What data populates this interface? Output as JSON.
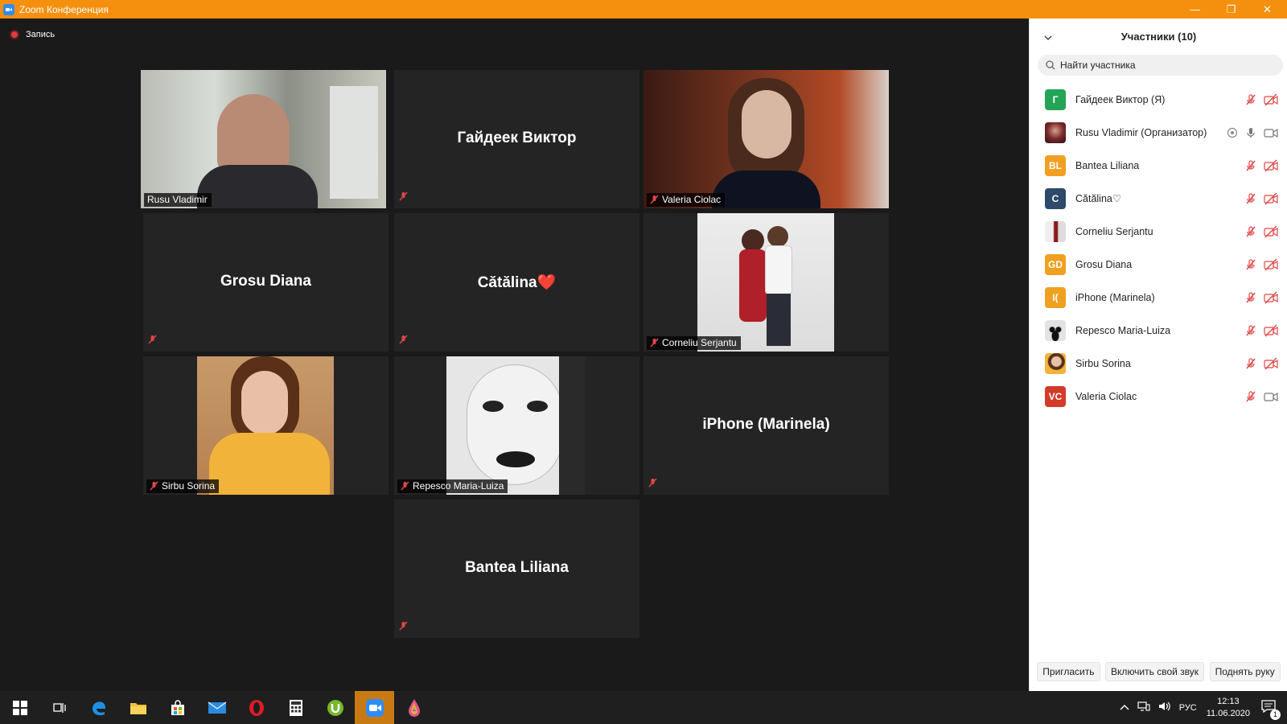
{
  "window": {
    "title": "Zoom Конференция",
    "minimize": "—",
    "restore": "❐",
    "close": "✕"
  },
  "recording": {
    "label": "Запись"
  },
  "tiles": [
    {
      "name": "Rusu Vladimir",
      "type": "video"
    },
    {
      "name": "Гайдеек Виктор",
      "type": "name"
    },
    {
      "name": "Valeria Ciolac",
      "type": "video"
    },
    {
      "name": "Grosu Diana",
      "type": "name"
    },
    {
      "name": "Cătălina❤️",
      "type": "name"
    },
    {
      "name": "Corneliu Serjantu",
      "type": "video"
    },
    {
      "name": "Sirbu Sorina",
      "type": "video"
    },
    {
      "name": "Repesco Maria-Luiza",
      "type": "video"
    },
    {
      "name": "iPhone (Marinela)",
      "type": "name"
    },
    {
      "name": "Bantea Liliana",
      "type": "name"
    }
  ],
  "panel": {
    "title": "Участники (10)",
    "search_placeholder": "Найти участника",
    "participants": [
      {
        "name": "Гайдеек Виктор (Я)",
        "initials": "Г",
        "color": "#23a456"
      },
      {
        "name": "Rusu Vladimir (Организатор)",
        "initials": "",
        "color": "#7a2a2a"
      },
      {
        "name": "Bantea Liliana",
        "initials": "BL",
        "color": "#f0a020"
      },
      {
        "name": "Cătălina♡",
        "initials": "C",
        "color": "#2d4a6b"
      },
      {
        "name": "Corneliu Serjantu",
        "initials": "",
        "color": "#c9b2a8"
      },
      {
        "name": "Grosu Diana",
        "initials": "GD",
        "color": "#f0a020"
      },
      {
        "name": "iPhone (Marinela)",
        "initials": "I(",
        "color": "#f0a020"
      },
      {
        "name": "Repesco Maria-Luiza",
        "initials": "",
        "color": "#d8d8d8"
      },
      {
        "name": "Sirbu Sorina",
        "initials": "",
        "color": "#d9a060"
      },
      {
        "name": "Valeria Ciolac",
        "initials": "VC",
        "color": "#d23a2a"
      }
    ],
    "buttons": {
      "invite": "Пригласить",
      "unmute": "Включить свой звук",
      "raise_hand": "Поднять руку"
    }
  },
  "taskbar": {
    "lang": "РУС",
    "time": "12:13",
    "date": "11.06.2020",
    "notifications": "1"
  }
}
